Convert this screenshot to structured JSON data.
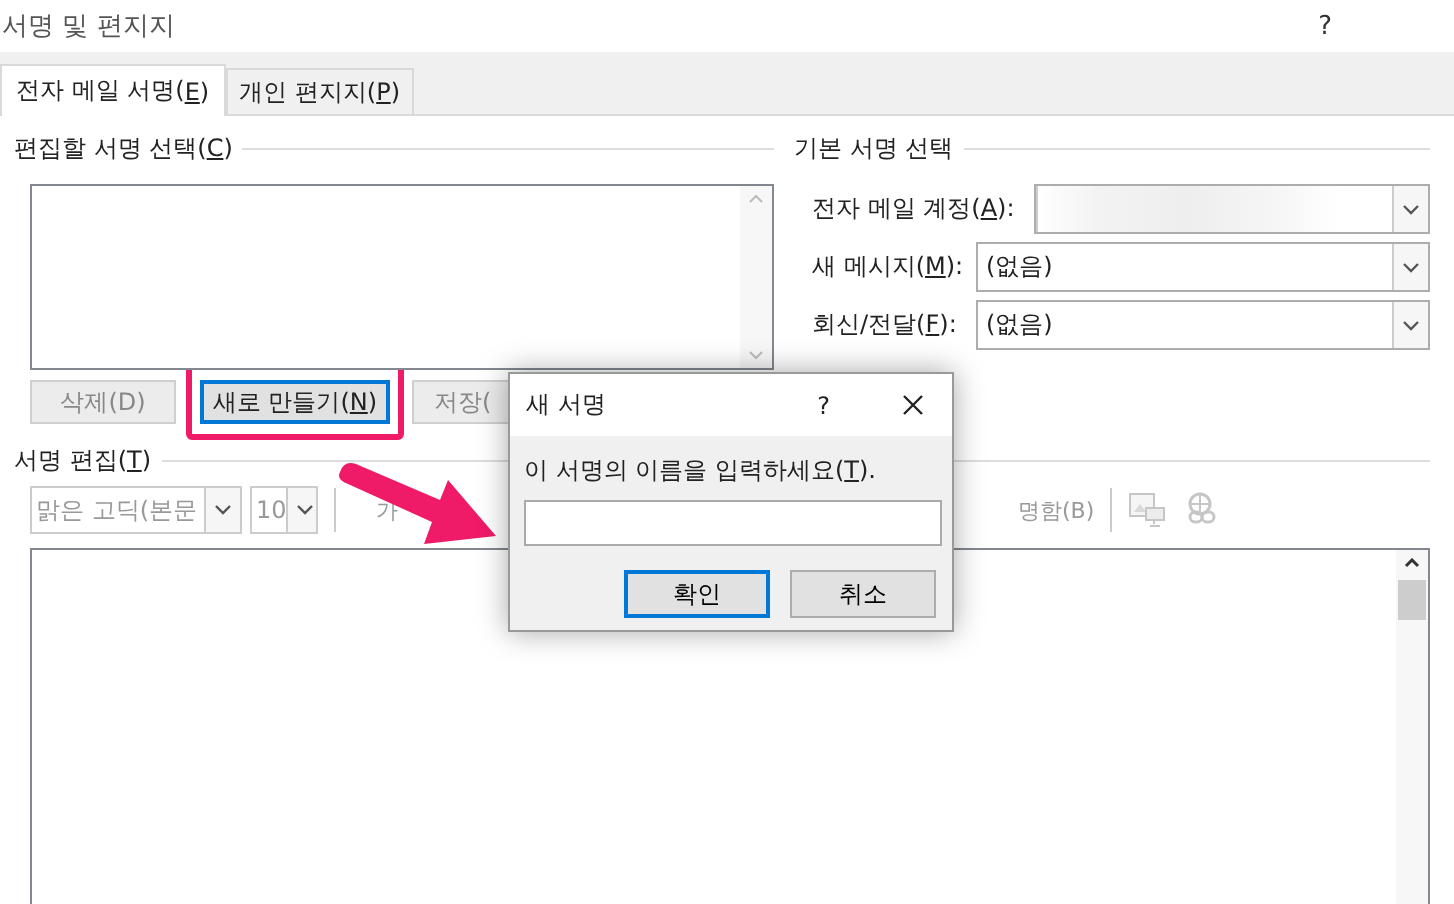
{
  "window": {
    "title": "서명 및 편지지",
    "help": "?"
  },
  "tabs": [
    {
      "label": "전자 메일 서명(E)",
      "selected": true
    },
    {
      "label": "개인 편지지(P)",
      "selected": false
    }
  ],
  "select_section": {
    "title": "편집할 서명 선택(C)"
  },
  "buttons": [
    {
      "label": "삭제(D)",
      "disabled": true,
      "focused": false,
      "highlighted": false
    },
    {
      "label": "새로 만들기(N)",
      "disabled": false,
      "focused": true,
      "highlighted": true
    },
    {
      "label": "저장(",
      "disabled": true,
      "focused": false,
      "highlighted": false
    }
  ],
  "default_section": {
    "title": "기본 서명 선택",
    "fields": [
      {
        "label": "전자 메일 계정(A):",
        "redacted": true
      },
      {
        "label": "새 메시지(M):",
        "value": "(없음)"
      },
      {
        "label": "회신/전달(F):",
        "value": "(없음)"
      }
    ]
  },
  "edit_section": {
    "title": "서명 편집(T)",
    "font": "맑은 고딕(본문",
    "size": "10",
    "tools": [
      {
        "kind": "text",
        "label": "가",
        "disabled": true
      },
      {
        "kind": "text",
        "label": "명함(B)",
        "disabled": true
      },
      {
        "kind": "image",
        "disabled": true
      },
      {
        "kind": "link",
        "disabled": true
      }
    ]
  },
  "dialog": {
    "title": "새 서명",
    "help": "?",
    "prompt": "이 서명의 이름을 입력하세요(T).",
    "buttons": [
      {
        "label": "확인",
        "focused": true
      },
      {
        "label": "취소",
        "focused": false
      }
    ]
  }
}
